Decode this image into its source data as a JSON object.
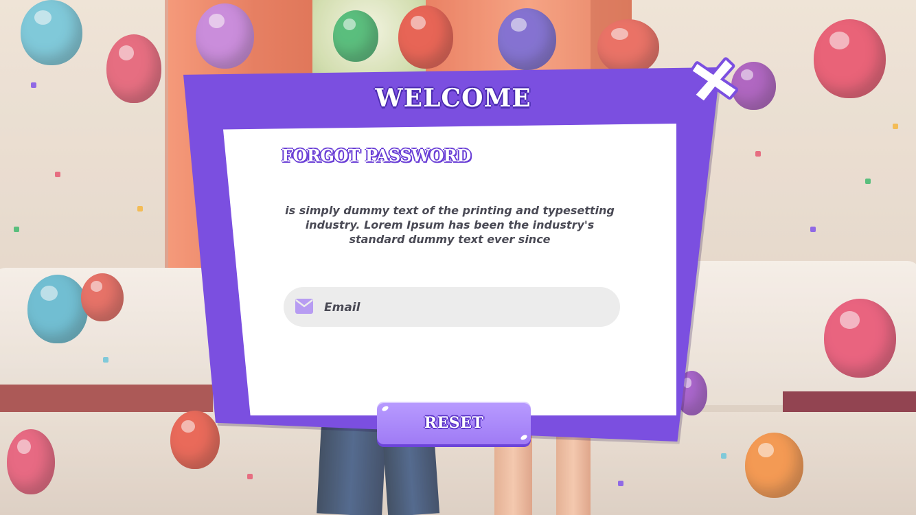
{
  "dialog": {
    "title": "WELCOME",
    "subtitle": "FORGOT PASSWORD",
    "description": "is simply dummy text of the printing and typesetting industry. Lorem Ipsum has been the industry's standard dummy text ever since",
    "email": {
      "placeholder": "Email",
      "value": "",
      "icon": "envelope-icon"
    },
    "reset_label": "RESET",
    "close_icon": "close-x-icon"
  },
  "colors": {
    "frame": "#7b4fe0",
    "button": "#a98af9",
    "text": "#4a4a55",
    "input_bg": "#ececec"
  }
}
